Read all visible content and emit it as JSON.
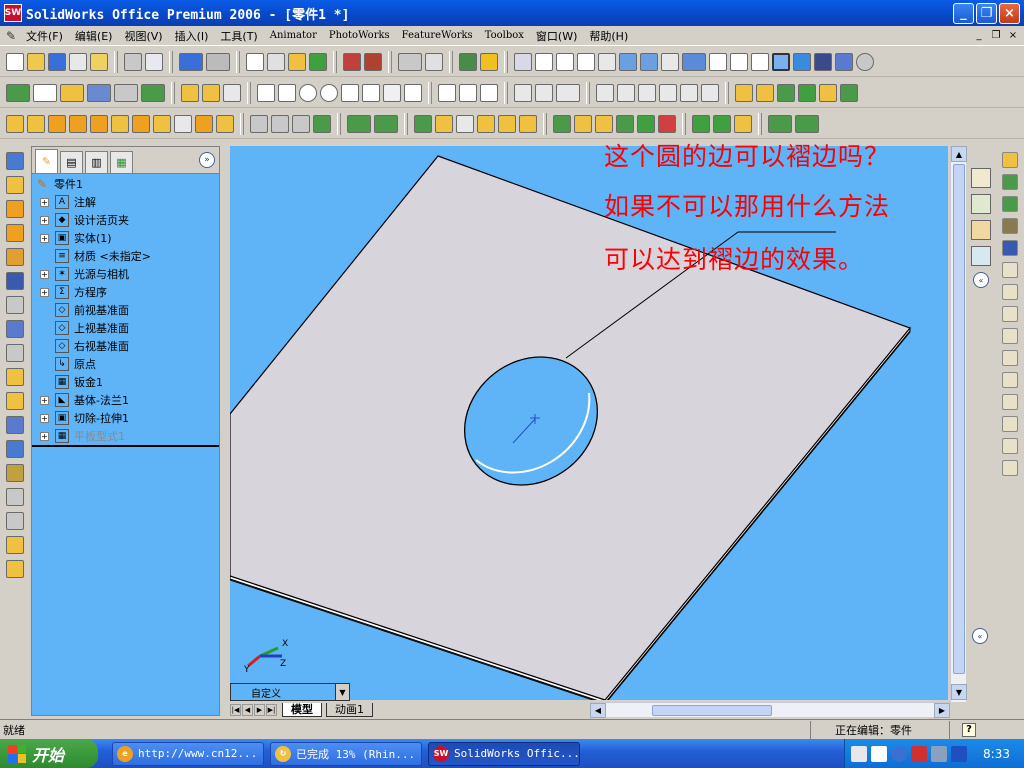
{
  "window": {
    "title": "SolidWorks Office Premium 2006 - [零件1 *]",
    "app_icon": "SW",
    "controls": [
      "_",
      "❐",
      "×"
    ]
  },
  "menu": {
    "items": [
      "文件(F)",
      "编辑(E)",
      "视图(V)",
      "插入(I)",
      "工具(T)",
      "Animator",
      "PhotoWorks",
      "FeatureWorks",
      "Toolbox",
      "窗口(W)",
      "帮助(H)"
    ],
    "doc_controls": [
      "_",
      "❐",
      "×"
    ]
  },
  "tree_panel": {
    "tabs": [
      "featuremanager-tab",
      "propertymanager-tab",
      "configurationmanager-tab",
      "display-tab"
    ],
    "expand_label": "»",
    "root": "零件1",
    "nodes": [
      {
        "label": "注解",
        "icon": "A",
        "expandable": true
      },
      {
        "label": "设计活页夹",
        "icon": "◆",
        "expandable": true
      },
      {
        "label": "实体(1)",
        "icon": "▣",
        "expandable": true
      },
      {
        "label": "材质 <未指定>",
        "icon": "≡",
        "expandable": false
      },
      {
        "label": "光源与相机",
        "icon": "✶",
        "expandable": true
      },
      {
        "label": "方程序",
        "icon": "Σ",
        "expandable": true
      },
      {
        "label": "前视基准面",
        "icon": "◇",
        "expandable": false
      },
      {
        "label": "上视基准面",
        "icon": "◇",
        "expandable": false
      },
      {
        "label": "右视基准面",
        "icon": "◇",
        "expandable": false
      },
      {
        "label": "原点",
        "icon": "↳",
        "expandable": false
      },
      {
        "label": "钣金1",
        "icon": "▦",
        "expandable": false
      },
      {
        "label": "基体-法兰1",
        "icon": "◣",
        "expandable": true
      },
      {
        "label": "切除-拉伸1",
        "icon": "▣",
        "expandable": true
      },
      {
        "label": "平板型式1",
        "icon": "▦",
        "expandable": true,
        "suppressed": true
      }
    ]
  },
  "annotation": {
    "lines": [
      "这个圆的边可以褶边吗？",
      "如果不可以那用什么方法",
      "可以达到褶边的效果。"
    ],
    "color": "#ff0000"
  },
  "viewport": {
    "background": "#5fb4f8",
    "part_color": "#d8d4dc"
  },
  "view_selector": {
    "value": "自定义",
    "arrow": "▼"
  },
  "bottom_tabs": {
    "items": [
      "模型",
      "动画1"
    ],
    "nav": [
      "|◀",
      "◀",
      "▶",
      "▶|"
    ]
  },
  "scroll": {
    "up": "▲",
    "down": "▼",
    "left": "◀",
    "right": "▶"
  },
  "status": {
    "left": "就绪",
    "mode": "正在编辑：零件",
    "help": "?"
  },
  "taskbar": {
    "start": "开始",
    "tasks": [
      {
        "label": "http://www.cn12...",
        "icon": "e",
        "color": "#f0a020"
      },
      {
        "label": "已完成 13% (Rhin...",
        "icon": "↻",
        "color": "#f0c040"
      },
      {
        "label": "SolidWorks Offic...",
        "icon": "SW",
        "color": "#c8102e",
        "active": true
      }
    ],
    "clock": "8:33"
  }
}
